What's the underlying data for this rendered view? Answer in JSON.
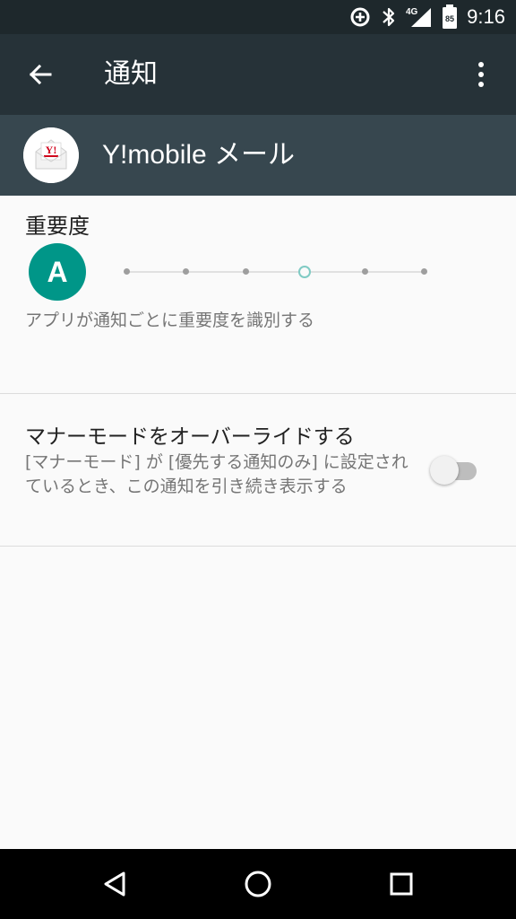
{
  "status_bar": {
    "time": "9:16",
    "network_label": "4G",
    "battery_level": "85",
    "icons": [
      "data-saver-icon",
      "bluetooth-icon",
      "signal-icon",
      "battery-icon"
    ]
  },
  "app_bar": {
    "title": "通知",
    "icons": [
      "back-arrow-icon",
      "more-vert-icon"
    ]
  },
  "app_header": {
    "app_name": "Y!mobile メール",
    "logo_text": "Y!"
  },
  "importance": {
    "title": "重要度",
    "level_letter": "A",
    "description": "アプリが通知ごとに重要度を識別する",
    "slider_levels": 6,
    "slider_selected": 4
  },
  "dnd_override": {
    "title": "マナーモードをオーバーライドする",
    "description": "[マナーモード] が [優先する通知のみ] に設定されているとき、この通知を引き続き表示する",
    "enabled": false
  },
  "nav_bar": {
    "icons": [
      "back-triangle-icon",
      "home-circle-icon",
      "recents-square-icon"
    ]
  },
  "colors": {
    "status_bar": "#1e282c",
    "app_bar": "#263238",
    "app_header": "#37474f",
    "accent": "#009688",
    "background": "#fafafa"
  }
}
